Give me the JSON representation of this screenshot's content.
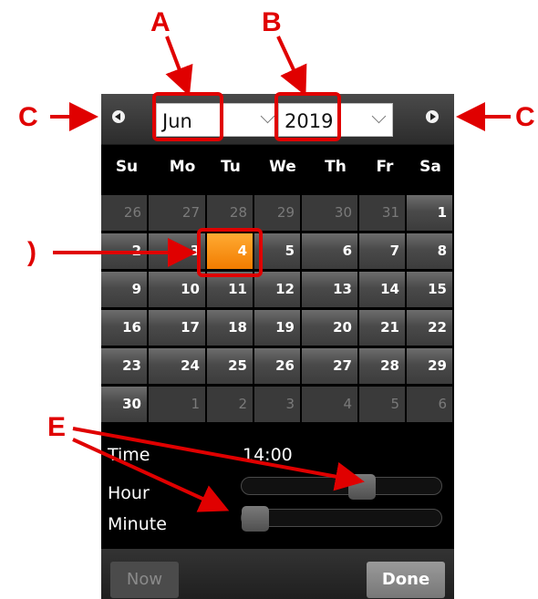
{
  "header": {
    "month_value": "Jun",
    "year_value": "2019"
  },
  "weekdays": [
    "Su",
    "Mo",
    "Tu",
    "We",
    "Th",
    "Fr",
    "Sa"
  ],
  "days": [
    [
      {
        "d": "26",
        "t": "other"
      },
      {
        "d": "27",
        "t": "other"
      },
      {
        "d": "28",
        "t": "other"
      },
      {
        "d": "29",
        "t": "other"
      },
      {
        "d": "30",
        "t": "other"
      },
      {
        "d": "31",
        "t": "other"
      },
      {
        "d": "1",
        "t": "cur"
      }
    ],
    [
      {
        "d": "2",
        "t": "cur"
      },
      {
        "d": "3",
        "t": "cur"
      },
      {
        "d": "4",
        "t": "sel"
      },
      {
        "d": "5",
        "t": "cur"
      },
      {
        "d": "6",
        "t": "cur"
      },
      {
        "d": "7",
        "t": "cur"
      },
      {
        "d": "8",
        "t": "cur"
      }
    ],
    [
      {
        "d": "9",
        "t": "cur"
      },
      {
        "d": "10",
        "t": "cur"
      },
      {
        "d": "11",
        "t": "cur"
      },
      {
        "d": "12",
        "t": "cur"
      },
      {
        "d": "13",
        "t": "cur"
      },
      {
        "d": "14",
        "t": "cur"
      },
      {
        "d": "15",
        "t": "cur"
      }
    ],
    [
      {
        "d": "16",
        "t": "cur"
      },
      {
        "d": "17",
        "t": "cur"
      },
      {
        "d": "18",
        "t": "cur"
      },
      {
        "d": "19",
        "t": "cur"
      },
      {
        "d": "20",
        "t": "cur"
      },
      {
        "d": "21",
        "t": "cur"
      },
      {
        "d": "22",
        "t": "cur"
      }
    ],
    [
      {
        "d": "23",
        "t": "cur"
      },
      {
        "d": "24",
        "t": "cur"
      },
      {
        "d": "25",
        "t": "cur"
      },
      {
        "d": "26",
        "t": "cur"
      },
      {
        "d": "27",
        "t": "cur"
      },
      {
        "d": "28",
        "t": "cur"
      },
      {
        "d": "29",
        "t": "cur"
      }
    ],
    [
      {
        "d": "30",
        "t": "cur"
      },
      {
        "d": "1",
        "t": "other"
      },
      {
        "d": "2",
        "t": "other"
      },
      {
        "d": "3",
        "t": "other"
      },
      {
        "d": "4",
        "t": "other"
      },
      {
        "d": "5",
        "t": "other"
      },
      {
        "d": "6",
        "t": "other"
      }
    ]
  ],
  "time": {
    "label": "Time",
    "value": "14:00",
    "hour_label": "Hour",
    "minute_label": "Minute",
    "hour_fraction": 0.61,
    "minute_fraction": 0.0
  },
  "footer": {
    "now_label": "Now",
    "done_label": "Done"
  },
  "annotations": {
    "a": "A",
    "b": "B",
    "c_left": "C",
    "c_right": "C",
    "d": ")",
    "e": "E"
  },
  "colors": {
    "annotation": "#e00000",
    "selected_day": "#f27c00",
    "panel": "#000000"
  }
}
